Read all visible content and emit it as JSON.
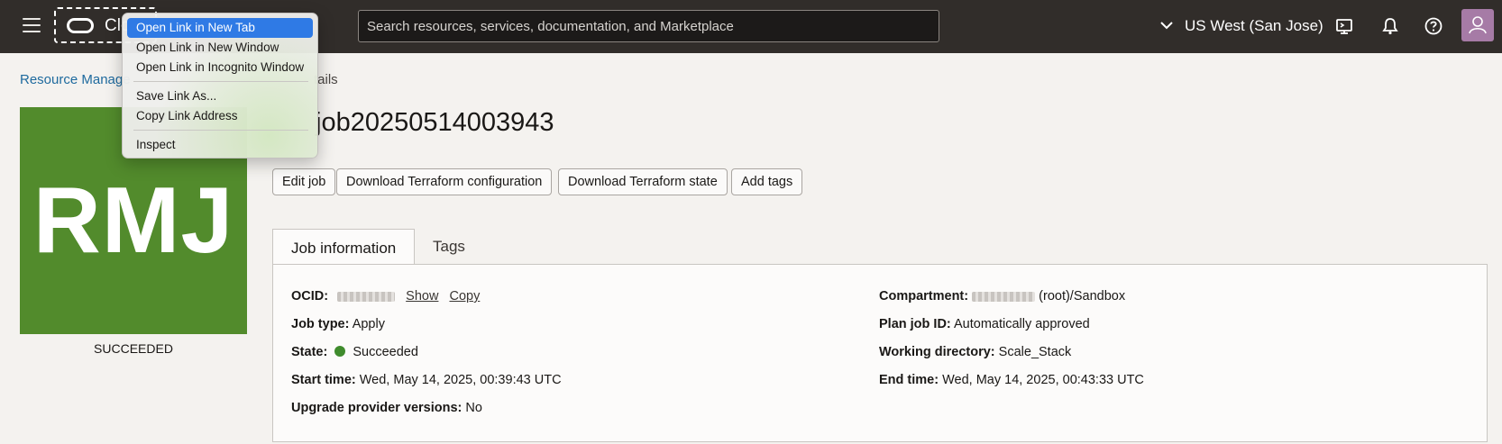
{
  "header": {
    "logo_text": "Clo",
    "search_placeholder": "Search resources, services, documentation, and Marketplace",
    "region": "US West (San Jose)",
    "icons": [
      "menu-icon",
      "chevron-down-icon",
      "cloud-shell-icon",
      "bell-icon",
      "help-icon",
      "avatar-icon"
    ]
  },
  "breadcrumb": {
    "first": "Resource Manage",
    "rest": "tails"
  },
  "tile": {
    "initials": "RMJ",
    "status": "SUCCEEDED",
    "color": "#528b2c"
  },
  "title": "job20250514003943",
  "actions": {
    "edit": "Edit job",
    "download_config": "Download Terraform configuration",
    "download_state": "Download Terraform state",
    "add_tags": "Add tags"
  },
  "tabs": {
    "active": "Job information",
    "other": "Tags"
  },
  "info": {
    "ocid_label": "OCID:",
    "show": "Show",
    "copy": "Copy",
    "job_type_label": "Job type:",
    "job_type": "Apply",
    "state_label": "State:",
    "state": "Succeeded",
    "start_time_label": "Start time:",
    "start_time": "Wed, May 14, 2025, 00:39:43 UTC",
    "upgrade_label": "Upgrade provider versions:",
    "upgrade": "No",
    "compartment_label": "Compartment:",
    "compartment_suffix": "(root)/Sandbox",
    "plan_label": "Plan job ID:",
    "plan": "Automatically approved",
    "workdir_label": "Working directory:",
    "workdir": "Scale_Stack",
    "end_time_label": "End time:",
    "end_time": "Wed, May 14, 2025, 00:43:33 UTC"
  },
  "context_menu": {
    "open_new_tab": "Open Link in New Tab",
    "open_new_window": "Open Link in New Window",
    "open_incognito": "Open Link in Incognito Window",
    "save_link": "Save Link As...",
    "copy_link": "Copy Link Address",
    "inspect": "Inspect"
  }
}
